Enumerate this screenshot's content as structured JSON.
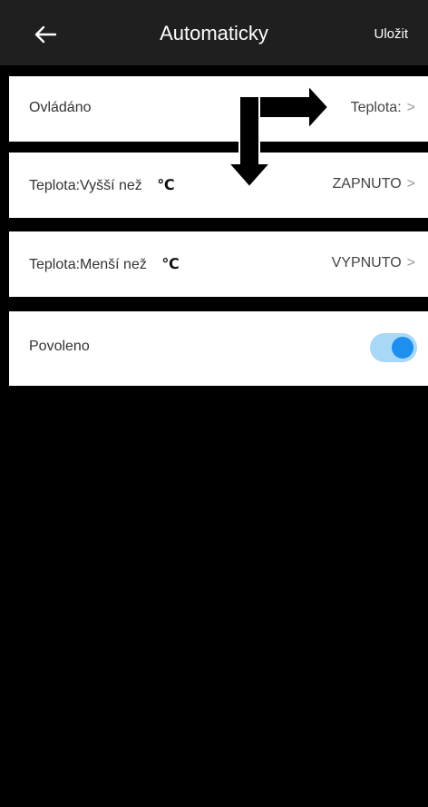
{
  "header": {
    "back_icon": "arrow-left-icon",
    "title": "Automaticky",
    "save_label": "Uložit"
  },
  "rows": [
    {
      "label": "Ovládáno",
      "value": "Teplota:",
      "chevron": ">"
    },
    {
      "label": "Teplota:Vyšší než",
      "unit": "℃",
      "value": "ZAPNUTO",
      "chevron": ">"
    },
    {
      "label": "Teplota:Menší než",
      "unit": "℃",
      "value": "VYPNUTO",
      "chevron": ">"
    },
    {
      "label": "Povoleno",
      "toggle_on": true
    }
  ],
  "colors": {
    "header_bg": "#1f1f1f",
    "toggle_track": "#a9d8f6",
    "toggle_knob": "#1e8fee"
  }
}
